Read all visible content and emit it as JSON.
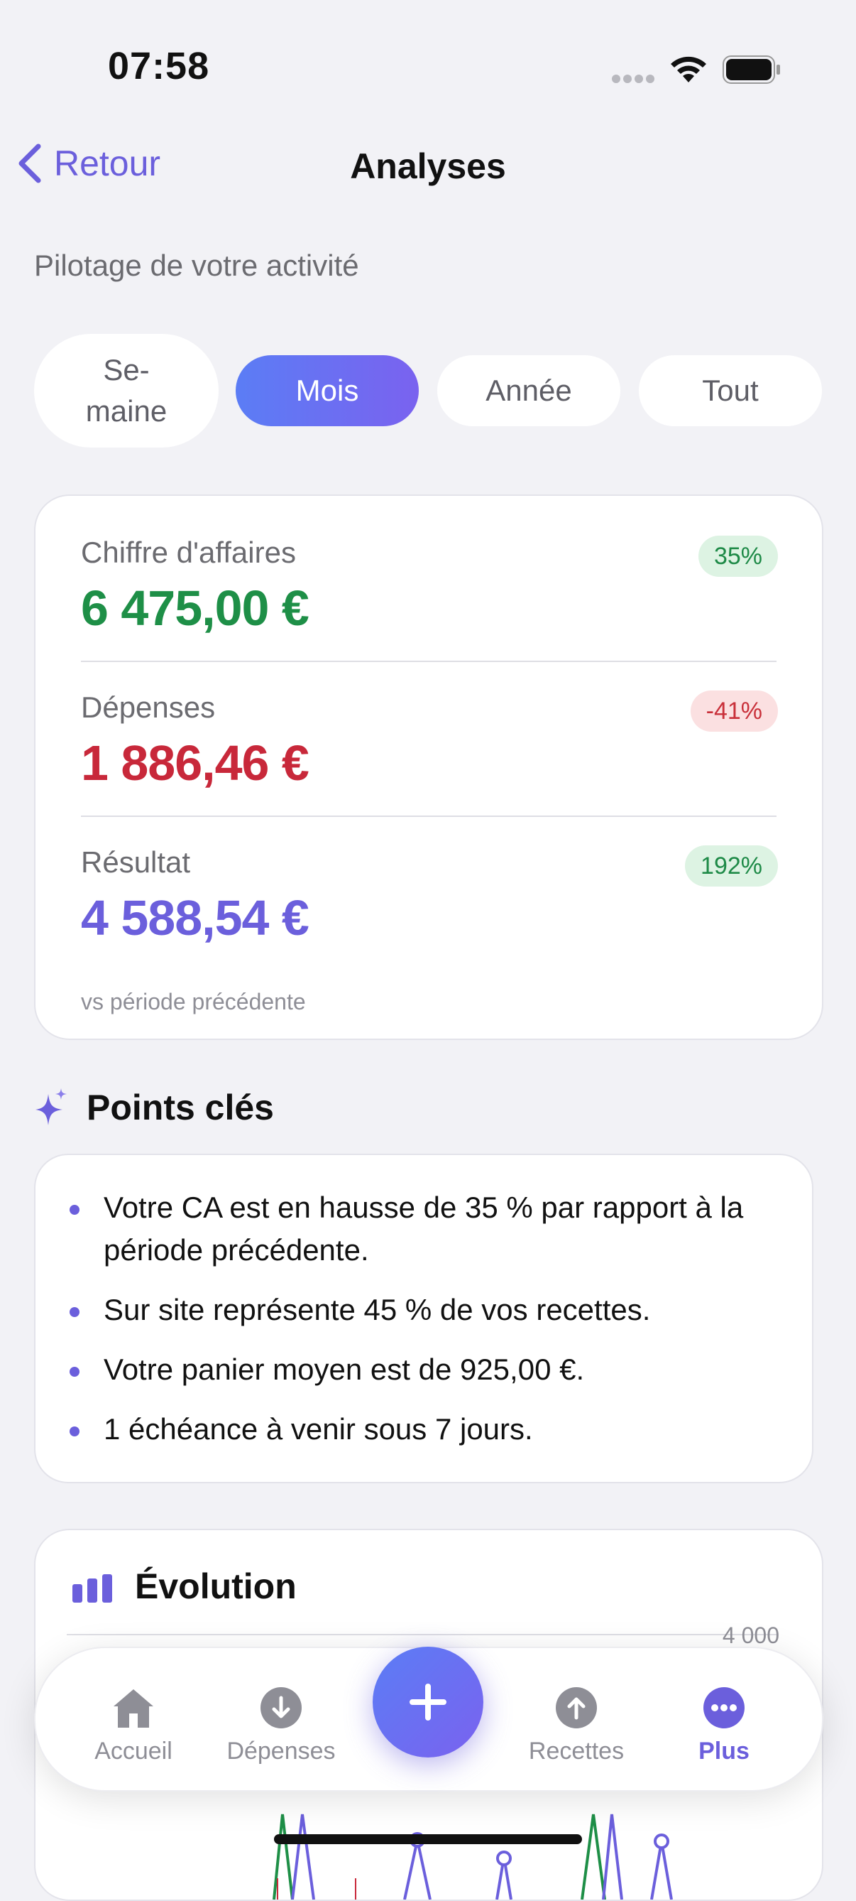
{
  "status": {
    "time": "07:58"
  },
  "nav": {
    "back_label": "Retour",
    "title": "Analyses"
  },
  "subtitle": "Pilotage de votre activité",
  "periods": [
    {
      "label": "Se-\nmaine",
      "active": false
    },
    {
      "label": "Mois",
      "active": true
    },
    {
      "label": "Année",
      "active": false
    },
    {
      "label": "Tout",
      "active": false
    }
  ],
  "kpis": {
    "revenue": {
      "label": "Chiffre d'affaires",
      "value": "6 475,00 €",
      "change": "35%",
      "trend": "up",
      "color": "#1e8f47"
    },
    "expenses": {
      "label": "Dépenses",
      "value": "1 886,46 €",
      "change": "-41%",
      "trend": "down",
      "color": "#c8283a"
    },
    "result": {
      "label": "Résultat",
      "value": "4 588,54 €",
      "change": "192%",
      "trend": "up",
      "color": "#6b5fdc"
    },
    "footnote": "vs période précédente"
  },
  "key_points": {
    "title": "Points clés",
    "icon": "sparkles-icon",
    "items": [
      "Votre CA est en hausse de 35 % par rapport à la période précédente.",
      "Sur site représente 45 % de vos recettes.",
      "Votre panier moyen est de 925,00 €.",
      "1 échéance à venir sous 7 jours."
    ]
  },
  "evolution": {
    "title": "Évolution",
    "icon": "bar-chart-icon",
    "y_tick_top": "4 000"
  },
  "tabbar": {
    "items": [
      {
        "label": "Accueil",
        "icon": "home-icon",
        "active": false
      },
      {
        "label": "Dépenses",
        "icon": "arrow-down-circle-icon",
        "active": false
      },
      {
        "label": "Recettes",
        "icon": "arrow-up-circle-icon",
        "active": false
      },
      {
        "label": "Plus",
        "icon": "more-circle-icon",
        "active": true
      }
    ],
    "fab_icon": "plus-icon"
  }
}
